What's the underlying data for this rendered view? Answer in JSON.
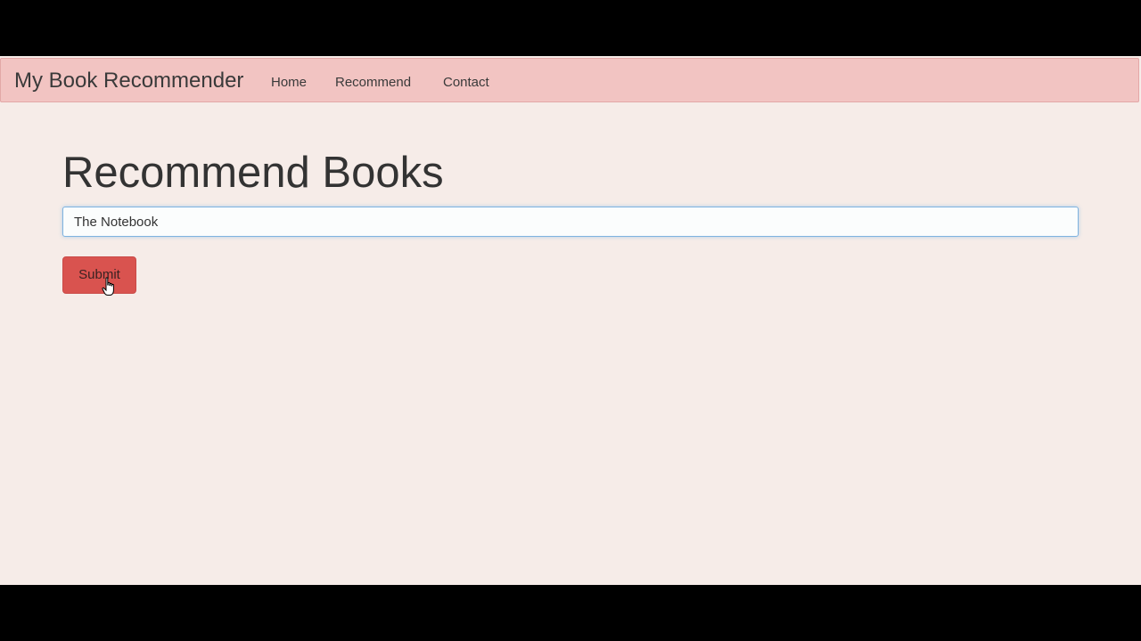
{
  "navbar": {
    "brand": "My Book Recommender",
    "links": [
      {
        "label": "Home"
      },
      {
        "label": "Recommend"
      },
      {
        "label": "Contact"
      }
    ]
  },
  "main": {
    "title": "Recommend Books",
    "search": {
      "value": "The Notebook"
    },
    "submit_label": "Submit"
  },
  "colors": {
    "navbar_bg": "#f2c4c2",
    "page_bg": "#f6ece8",
    "button_bg": "#d9534f",
    "input_focus_border": "#7fb3e0"
  },
  "icons": {
    "cursor": "hand-pointer-icon"
  }
}
